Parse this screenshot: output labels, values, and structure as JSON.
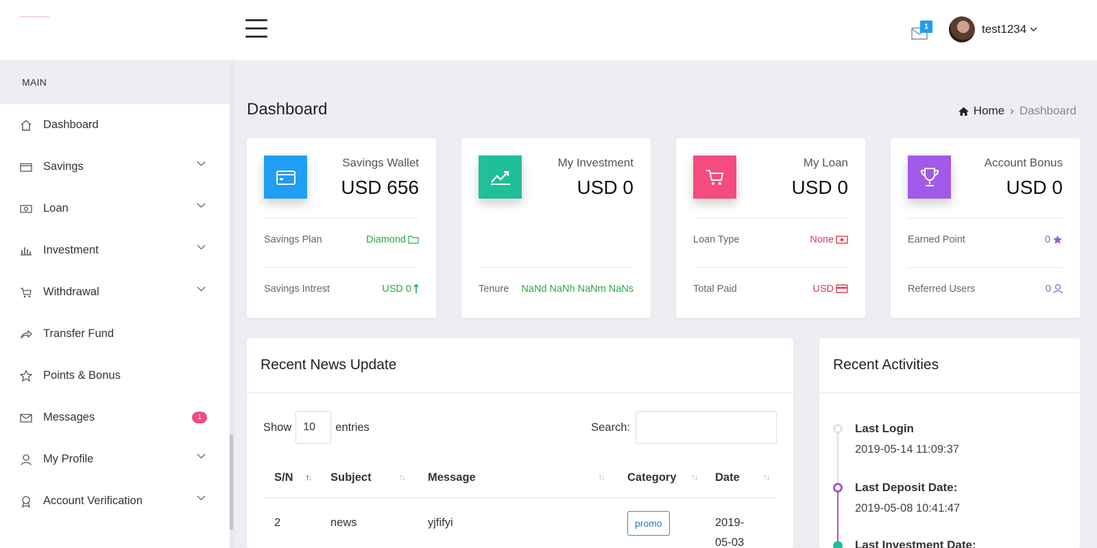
{
  "sidebar": {
    "section": "MAIN",
    "items": [
      {
        "label": "Dashboard",
        "icon": "home-icon"
      },
      {
        "label": "Savings",
        "icon": "wallet-icon"
      },
      {
        "label": "Loan",
        "icon": "money-icon"
      },
      {
        "label": "Investment",
        "icon": "bar-chart-icon"
      },
      {
        "label": "Withdrawal",
        "icon": "cart-icon"
      },
      {
        "label": "Transfer Fund",
        "icon": "share-icon"
      },
      {
        "label": "Points & Bonus",
        "icon": "star-icon"
      },
      {
        "label": "Messages",
        "icon": "envelope-icon",
        "badge": "1"
      },
      {
        "label": "My Profile",
        "icon": "user-icon"
      },
      {
        "label": "Account Verification",
        "icon": "badge-icon"
      }
    ]
  },
  "header": {
    "mail_count": "1",
    "username": "test1234"
  },
  "page": {
    "title": "Dashboard",
    "breadcrumb": {
      "home": "Home",
      "current": "Dashboard"
    }
  },
  "cards": [
    {
      "label": "Savings Wallet",
      "value": "USD 656",
      "color": "#1e9ff2",
      "row1": {
        "k": "Savings Plan",
        "v": "Diamond",
        "color": "#28a745"
      },
      "row2": {
        "k": "Savings Intrest",
        "v": "USD 0",
        "color": "#28a745"
      }
    },
    {
      "label": "My Investment",
      "value": "USD 0",
      "color": "#1fbf99",
      "row2": {
        "k": "Tenure",
        "v": "NaNd NaNh NaNm NaNs",
        "color": "#28a745"
      }
    },
    {
      "label": "My Loan",
      "value": "USD 0",
      "color": "#f54b7e",
      "row1": {
        "k": "Loan Type",
        "v": "None",
        "color": "#e53950"
      },
      "row2": {
        "k": "Total Paid",
        "v": "USD",
        "color": "#e53950"
      }
    },
    {
      "label": "Account Bonus",
      "value": "USD 0",
      "color": "#a25ae8",
      "row1": {
        "k": "Earned Point",
        "v": "0",
        "color": "#9b59d0"
      },
      "row2": {
        "k": "Referred Users",
        "v": "0",
        "color": "#9b59d0"
      }
    }
  ],
  "news": {
    "title": "Recent News Update",
    "show_label": "Show",
    "show_value": "10",
    "entries_label": "entries",
    "search_label": "Search:",
    "columns": [
      "S/N",
      "Subject",
      "Message",
      "Category",
      "Date"
    ],
    "rows": [
      {
        "sn": "2",
        "subject": "news",
        "message": "yjfifyi",
        "category": "promo",
        "date_line1": "2019-",
        "date_line2": "05-03"
      }
    ]
  },
  "activity": {
    "title": "Recent Activities",
    "items": [
      {
        "head": "Last Login",
        "time": "2019-05-14 11:09:37"
      },
      {
        "head": "Last Deposit Date:",
        "time": "2019-05-08 10:41:47"
      },
      {
        "head": "Last Investment Date:",
        "time": ""
      }
    ]
  }
}
